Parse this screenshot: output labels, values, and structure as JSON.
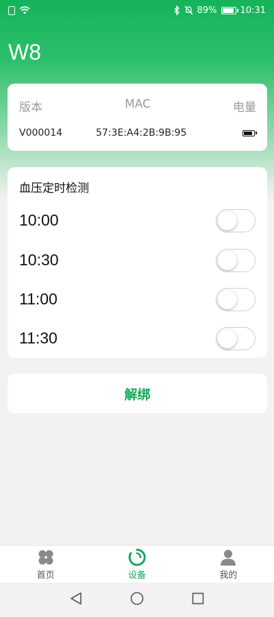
{
  "status_bar": {
    "battery_percent": "89%",
    "time": "10:31"
  },
  "app": {
    "title": "W8"
  },
  "device_info": {
    "headers": {
      "version": "版本",
      "mac": "MAC",
      "battery": "电量"
    },
    "values": {
      "version": "V000014",
      "mac": "57:3E:A4:2B:9B:95",
      "battery_level": 0.75
    }
  },
  "schedule": {
    "title": "血压定时检测",
    "items": [
      {
        "time": "10:00",
        "enabled": false
      },
      {
        "time": "10:30",
        "enabled": false
      },
      {
        "time": "11:00",
        "enabled": false
      },
      {
        "time": "11:30",
        "enabled": false
      }
    ]
  },
  "unbind": {
    "label": "解绑"
  },
  "bottom_nav": {
    "items": [
      {
        "label": "首页",
        "icon": "clover-icon",
        "active": false
      },
      {
        "label": "设备",
        "icon": "device-ring-icon",
        "active": true
      },
      {
        "label": "我的",
        "icon": "person-icon",
        "active": false
      }
    ]
  },
  "colors": {
    "primary": "#15a85a",
    "gradient_top": "#15b35a"
  }
}
